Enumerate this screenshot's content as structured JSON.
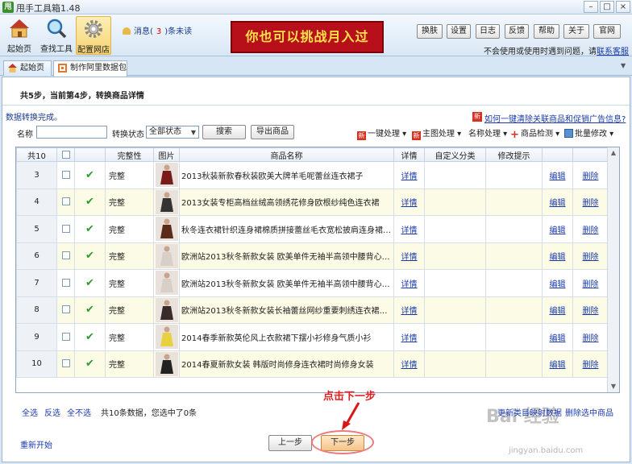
{
  "window": {
    "title": "甩手工具箱1.48",
    "app_icon_text": "甩"
  },
  "toolbar": {
    "tools": [
      {
        "label": "起始页"
      },
      {
        "label": "查找工具"
      },
      {
        "label": "配置网店"
      }
    ],
    "message": {
      "prefix": "消息(",
      "count": "3",
      "suffix": ")条未读"
    },
    "banner": "你也可以挑战月入过万！",
    "buttons": [
      "换肤",
      "设置",
      "日志",
      "反馈",
      "帮助",
      "关于",
      "官网"
    ],
    "help_note": "不会使用或使用时遇到问题，请",
    "help_link": "联系客服"
  },
  "tabs": [
    {
      "label": "起始页"
    },
    {
      "label": "制作阿里数据包"
    }
  ],
  "content": {
    "step_title": "共5步，当前第4步，转换商品详情",
    "status": "数据转换完成。",
    "howto_link": "如何一键清除关联商品和促销广告信息?",
    "howto_icon": "新",
    "filters": {
      "name_label": "名称",
      "name_value": "",
      "status_label": "转换状态",
      "status_value": "全部状态",
      "search_button": "搜索",
      "export_button": "导出商品"
    },
    "actions": [
      {
        "icon": "新",
        "label": "一键处理 ▾"
      },
      {
        "icon": "新",
        "label": "主图处理 ▾"
      },
      {
        "icon": "",
        "label": "名称处理 ▾"
      },
      {
        "icon": "+",
        "label": "商品检测 ▾"
      },
      {
        "icon": "",
        "label": "批量修改 ▾"
      }
    ],
    "table": {
      "headers": [
        "共10",
        "",
        "",
        "完整性",
        "图片",
        "商品名称",
        "详情",
        "自定义分类",
        "修改提示",
        "",
        ""
      ],
      "rows": [
        {
          "num": "3",
          "status": "完整",
          "name": "2013秋装新款春秋装欧美大牌羊毛呢蕾丝连衣裙子",
          "detail": "详情",
          "edit": "编辑",
          "del": "删除"
        },
        {
          "num": "4",
          "status": "完整",
          "name": "2013女装专柜高档丝绒高领绣花修身欧根纱纯色连衣裙",
          "detail": "详情",
          "edit": "编辑",
          "del": "删除"
        },
        {
          "num": "5",
          "status": "完整",
          "name": "秋冬连衣裙针织连身裙棉质拼接蕾丝毛衣宽松披肩连身裙明星...",
          "detail": "详情",
          "edit": "编辑",
          "del": "删除"
        },
        {
          "num": "6",
          "status": "完整",
          "name": "欧洲站2013秋冬新款女装 欧美单件无袖半高领中腰背心裙短裙",
          "detail": "详情",
          "edit": "编辑",
          "del": "删除"
        },
        {
          "num": "7",
          "status": "完整",
          "name": "欧洲站2013秋冬新款女装 欧美单件无袖半高领中腰背心裙短裙",
          "detail": "详情",
          "edit": "编辑",
          "del": "删除"
        },
        {
          "num": "8",
          "status": "完整",
          "name": "欧洲站2013秋冬新款女装长袖蕾丝网纱重要刺绣连衣裙少妇气...",
          "detail": "详情",
          "edit": "编辑",
          "del": "删除"
        },
        {
          "num": "9",
          "status": "完整",
          "name": "2014春季新款英伦风上衣款裙下摆小衫修身气质小衫",
          "detail": "详情",
          "edit": "编辑",
          "del": "删除"
        },
        {
          "num": "10",
          "status": "完整",
          "name": "2014春夏新款女装 韩版时尚修身连衣裙时尚修身女装",
          "detail": "详情",
          "edit": "编辑",
          "del": "删除"
        }
      ]
    },
    "selection": {
      "select_all": "全选",
      "invert": "反选",
      "select_none": "全不选",
      "info": "共10条数据，您选中了0条"
    },
    "right_links": {
      "update_category": "更新类目映射数据",
      "delete_selected": "删除选中商品"
    },
    "annotation": "点击下一步",
    "restart": "重新开始",
    "prev_button": "上一步",
    "next_button": "下一步"
  },
  "watermark": {
    "main": "Bai 经验",
    "sub": "jingyan.baidu.com"
  }
}
